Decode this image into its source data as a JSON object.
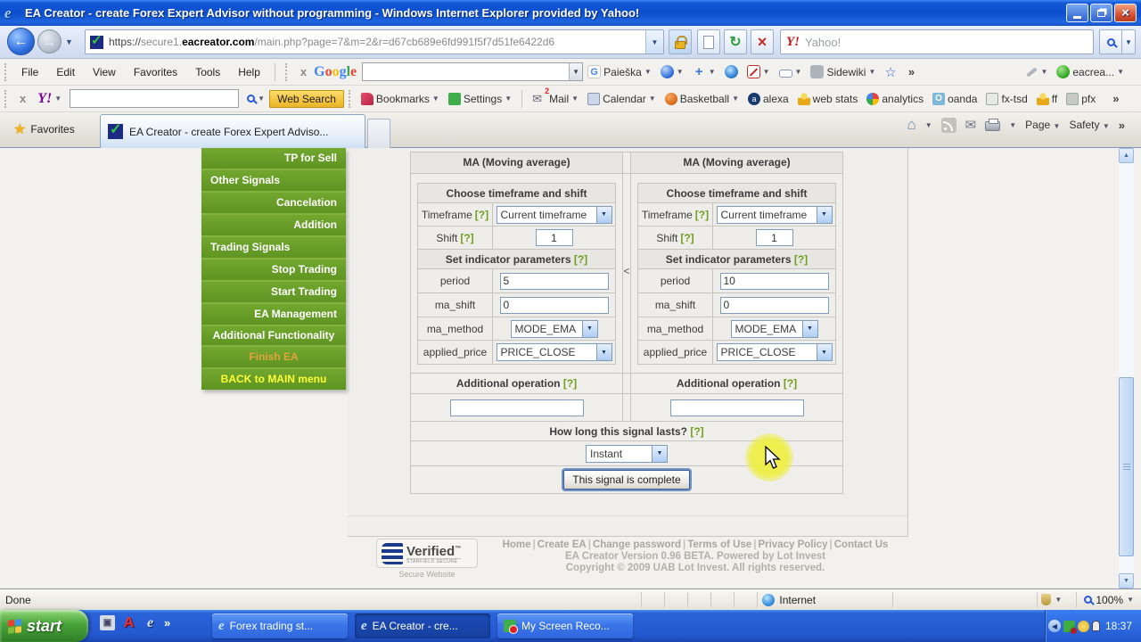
{
  "window": {
    "title": "EA Creator - create Forex Expert Advisor without programming - Windows Internet Explorer provided by Yahoo!"
  },
  "nav": {
    "url_scheme": "https://",
    "url_subdomain": "secure1.",
    "url_domain": "eacreator.com",
    "url_path": "/main.php?page=7&m=2&r=d67cb689e6fd991f5f7d51fe6422d6",
    "search_placeholder": "Yahoo!"
  },
  "menu": {
    "items": [
      "File",
      "Edit",
      "View",
      "Favorites",
      "Tools",
      "Help"
    ]
  },
  "google_bar": {
    "close": "x",
    "logo": "Google",
    "search_button": "Paieška",
    "sidewiki_label": "Sidewiki",
    "overflow": "»",
    "account": "eacrea..."
  },
  "yahoo_bar": {
    "close": "x",
    "logo": "Y!",
    "web_search": "Web Search",
    "bookmarks": "Bookmarks",
    "settings": "Settings",
    "mail": "Mail",
    "calendar": "Calendar",
    "basketball": "Basketball",
    "links": [
      "alexa",
      "web stats",
      "analytics",
      "oanda",
      "fx-tsd",
      "ff",
      "pfx"
    ],
    "overflow": "»"
  },
  "tab_bar": {
    "favorites": "Favorites",
    "active_tab": "EA Creator - create Forex Expert Adviso...",
    "page": "Page",
    "safety": "Safety",
    "overflow": "»"
  },
  "sidebar": {
    "items": [
      "TP for Sell",
      "Other Signals",
      "Cancelation",
      "Addition",
      "Trading Signals",
      "Stop Trading",
      "Start Trading",
      "EA Management",
      "Additional Functionality",
      "Finish EA",
      "BACK to MAIN menu"
    ]
  },
  "form": {
    "help": "[?]",
    "comparator": "<",
    "columns": [
      {
        "header": "MA (Moving average)",
        "tf_section": "Choose timeframe and shift",
        "tf_label": "Timeframe",
        "tf_value": "Current timeframe",
        "shift_label": "Shift",
        "shift_value": "1",
        "params_section": "Set indicator parameters",
        "period_label": "period",
        "period_value": "5",
        "ma_shift_label": "ma_shift",
        "ma_shift_value": "0",
        "ma_method_label": "ma_method",
        "ma_method_value": "MODE_EMA",
        "applied_price_label": "applied_price",
        "applied_price_value": "PRICE_CLOSE",
        "additional_label": "Additional operation"
      },
      {
        "header": "MA (Moving average)",
        "tf_section": "Choose timeframe and shift",
        "tf_label": "Timeframe",
        "tf_value": "Current timeframe",
        "shift_label": "Shift",
        "shift_value": "1",
        "params_section": "Set indicator parameters",
        "period_label": "period",
        "period_value": "10",
        "ma_shift_label": "ma_shift",
        "ma_shift_value": "0",
        "ma_method_label": "ma_method",
        "ma_method_value": "MODE_EMA",
        "applied_price_label": "applied_price",
        "applied_price_value": "PRICE_CLOSE",
        "additional_label": "Additional operation"
      }
    ],
    "duration_label": "How long this signal lasts?",
    "duration_value": "Instant",
    "submit": "This signal is complete"
  },
  "footer": {
    "seal_title": "Verified",
    "seal_tm": "™",
    "seal_sub": "STARFIELD SECURE",
    "seal_caption": "Secure Website",
    "links": [
      "Home",
      "Create EA",
      "Change password",
      "Terms of Use",
      "Privacy Policy",
      "Contact Us"
    ],
    "sep": "|",
    "version_line": "EA Creator Version 0.96 BETA. Powered by Lot Invest",
    "copyright_line": "Copyright © 2009 UAB Lot Invest. All rights reserved."
  },
  "status": {
    "text": "Done",
    "zone": "Internet",
    "zoom": "100%"
  },
  "taskbar": {
    "start": "start",
    "buttons": [
      "Forex trading st...",
      "EA Creator - cre...",
      "My Screen Reco..."
    ],
    "time": "18:37"
  },
  "colors": {
    "sidebar_green": "#699e21",
    "finish_orange": "#dca43c",
    "back_yellow": "#ffff32",
    "websearch_yellow": "#f6c63c",
    "title_blue": "#1658d6",
    "taskbar_blue": "#2a63d9",
    "start_green": "#51a234"
  }
}
